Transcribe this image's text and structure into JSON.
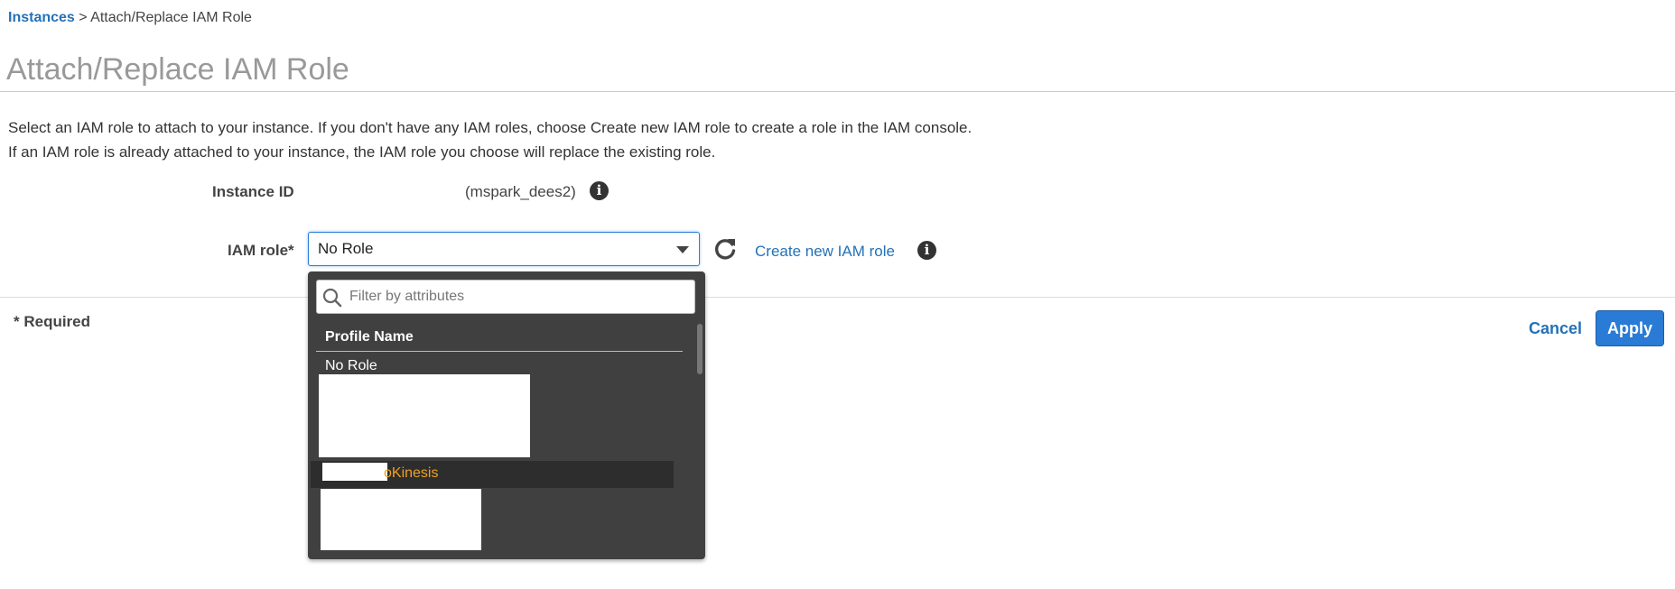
{
  "breadcrumb": {
    "link": "Instances",
    "separator": ">",
    "current": "Attach/Replace IAM Role"
  },
  "page_title": "Attach/Replace IAM Role",
  "description": {
    "line1": "Select an IAM role to attach to your instance. If you don't have any IAM roles, choose Create new IAM role to create a role in the IAM console.",
    "line2": "If an IAM role is already attached to your instance, the IAM role you choose will replace the existing role."
  },
  "instance": {
    "label": "Instance ID",
    "value": "(mspark_dees2)",
    "info_icon": "info-icon"
  },
  "iam_role": {
    "label": "IAM role*",
    "selected": "No Role",
    "create_link": "Create new IAM role",
    "refresh_icon": "refresh-icon",
    "info_icon": "info-icon"
  },
  "dropdown": {
    "filter_placeholder": "Filter by attributes",
    "column_header": "Profile Name",
    "options": [
      {
        "label": "No Role"
      },
      {
        "label": "",
        "redacted": true
      },
      {
        "label": "oKinesis",
        "highlighted": true,
        "partially_redacted": true
      },
      {
        "label": "",
        "redacted": true
      }
    ]
  },
  "footer": {
    "required_note": "* Required",
    "cancel_label": "Cancel",
    "apply_label": "Apply"
  },
  "colors": {
    "link": "#2471b8",
    "primary_button": "#2a7bd5",
    "dropdown_bg": "#404040",
    "highlight_text": "#f0a020"
  }
}
